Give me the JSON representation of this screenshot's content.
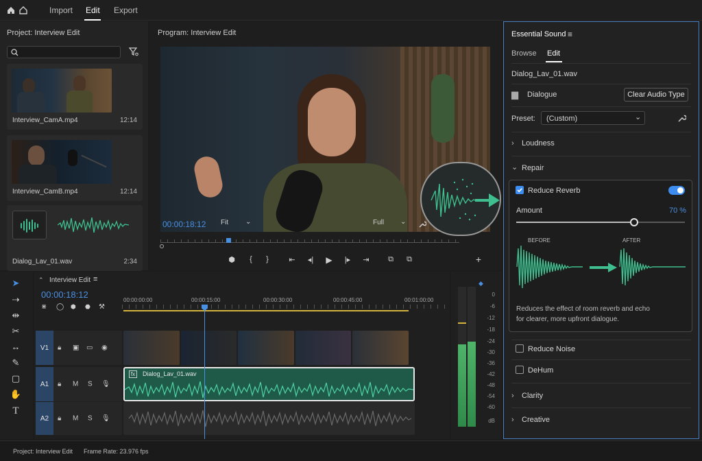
{
  "topbar": {
    "tabs": [
      {
        "label": "Import"
      },
      {
        "label": "Edit"
      },
      {
        "label": "Export"
      }
    ]
  },
  "project": {
    "title": "Project: Interview Edit",
    "items": [
      {
        "name": "Interview_CamA.mp4",
        "duration": "12:14"
      },
      {
        "name": "Interview_CamB.mp4",
        "duration": "12:14"
      },
      {
        "name": "Dialog_Lav_01.wav",
        "duration": "2:34"
      }
    ]
  },
  "program": {
    "title": "Program: Interview Edit",
    "timecode": "00:00:18:12",
    "fit_label": "Fit",
    "quality_label": "Full"
  },
  "timeline": {
    "title": "Interview Edit",
    "timecode": "00:00:18:12",
    "ruler": [
      "00:00:00:00",
      "00:00:15:00",
      "00:00:30:00",
      "00:00:45:00",
      "00:01:00:00"
    ],
    "tracks": [
      {
        "label": "V1"
      },
      {
        "label": "A1",
        "m": "M",
        "s": "S"
      },
      {
        "label": "A2",
        "m": "M",
        "s": "S"
      }
    ],
    "audio_clip_name": "Dialog_Lav_01.wav",
    "fx_badge": "fx"
  },
  "meter": {
    "labels": [
      "0",
      "-6",
      "-12",
      "-18",
      "-24",
      "-30",
      "-36",
      "-42",
      "-48",
      "-54",
      "-60",
      "dB"
    ]
  },
  "essential_sound": {
    "title": "Essential Sound",
    "tabs": [
      {
        "label": "Browse"
      },
      {
        "label": "Edit"
      }
    ],
    "clip_name": "Dialog_Lav_01.wav",
    "audio_type": "Dialogue",
    "clear_button": "Clear Audio Type",
    "preset_label": "Preset:",
    "preset_value": "(Custom)",
    "sections": {
      "loudness": "Loudness",
      "repair": "Repair",
      "clarity": "Clarity",
      "creative": "Creative"
    },
    "reduce_reverb": {
      "label": "Reduce Reverb",
      "enabled": true,
      "amount_label": "Amount",
      "amount_value": "70 %",
      "amount": 0.7
    },
    "before_label": "BEFORE",
    "after_label": "AFTER",
    "description": "Reduces the effect of room reverb and echo for clearer, more upfront dialogue.",
    "reduce_noise": {
      "label": "Reduce Noise",
      "enabled": false
    },
    "dehum": {
      "label": "DeHum",
      "enabled": false
    }
  },
  "statusbar": {
    "project": "Project: Interview Edit",
    "frame_rate": "Frame Rate: 23.976 fps"
  },
  "colors": {
    "accent": "#3d8cf0",
    "waveform": "#3fbf8f",
    "playhead": "#4a90e2"
  }
}
